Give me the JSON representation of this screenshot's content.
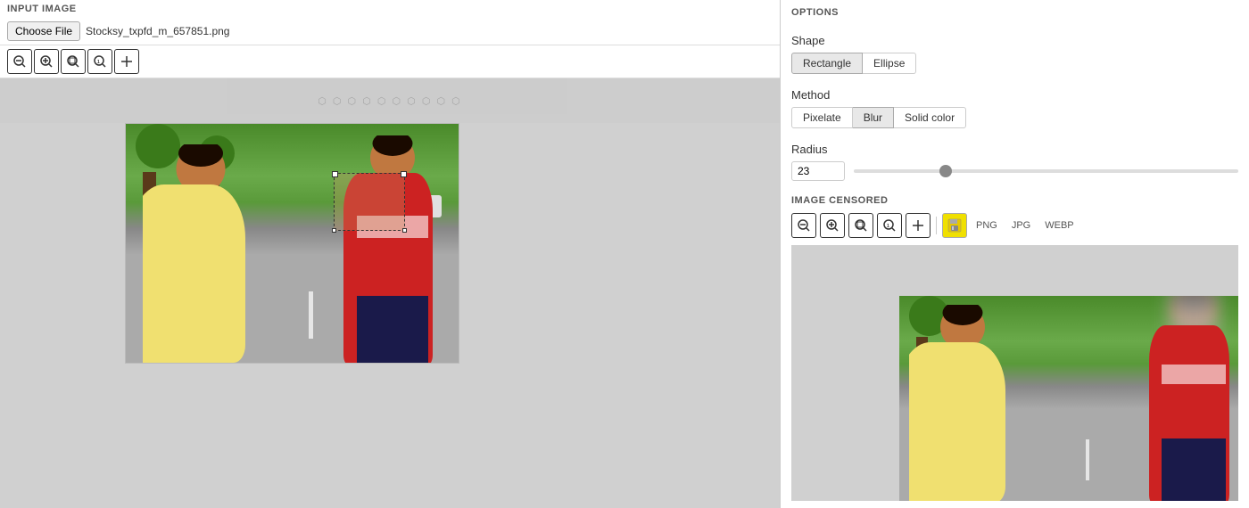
{
  "left_panel": {
    "header": "INPUT IMAGE",
    "file_button": "Choose File",
    "file_name": "Stocksy_txpfd_m_657851.png",
    "zoom_buttons": [
      {
        "icon": "🔍−",
        "name": "zoom-out",
        "symbol": "−"
      },
      {
        "icon": "🔍+",
        "name": "zoom-in-button",
        "symbol": "+"
      },
      {
        "icon": "🔍",
        "name": "zoom-fit",
        "symbol": "⊡"
      },
      {
        "icon": "🔍1",
        "name": "zoom-100",
        "symbol": "1"
      },
      {
        "icon": "+",
        "name": "zoom-crosshair",
        "symbol": "✚"
      }
    ]
  },
  "right_panel": {
    "header": "OPTIONS",
    "shape_label": "Shape",
    "shape_options": [
      "Rectangle",
      "Ellipse"
    ],
    "shape_active": "Rectangle",
    "method_label": "Method",
    "method_options": [
      "Pixelate",
      "Blur",
      "Solid color"
    ],
    "method_active": "Blur",
    "radius_label": "Radius",
    "radius_value": "23",
    "image_censored_header": "IMAGE CENSORED",
    "format_options": [
      "PNG",
      "JPG",
      "WEBP"
    ],
    "zoom_buttons": [
      {
        "symbol": "−",
        "name": "preview-zoom-out"
      },
      {
        "symbol": "+",
        "name": "preview-zoom-in"
      },
      {
        "symbol": "⊡",
        "name": "preview-zoom-fit"
      },
      {
        "symbol": "1",
        "name": "preview-zoom-100"
      },
      {
        "symbol": "✚",
        "name": "preview-zoom-crosshair"
      }
    ]
  }
}
